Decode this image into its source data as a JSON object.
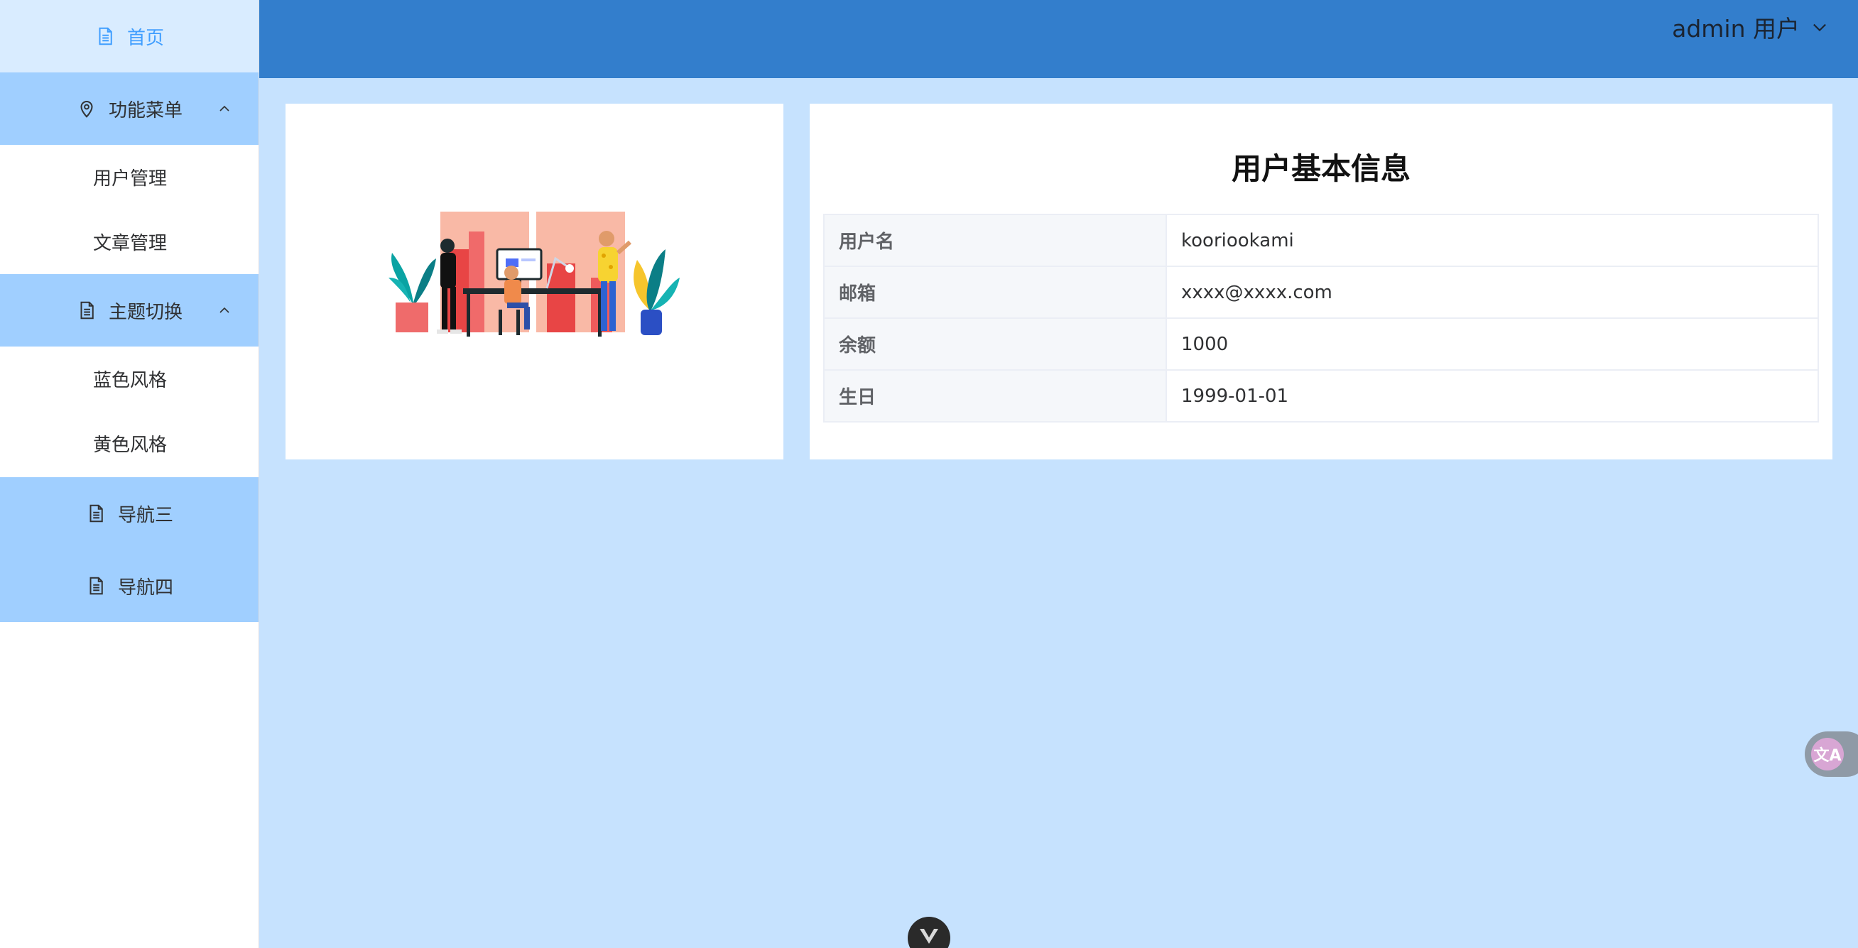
{
  "sidebar": {
    "home": {
      "label": "首页",
      "icon": "document-icon"
    },
    "function_menu": {
      "label": "功能菜单",
      "icon": "location-icon",
      "expanded": true,
      "children": [
        {
          "label": "用户管理"
        },
        {
          "label": "文章管理"
        }
      ]
    },
    "theme_switch": {
      "label": "主题切换",
      "icon": "document-icon",
      "expanded": true,
      "children": [
        {
          "label": "蓝色风格"
        },
        {
          "label": "黄色风格"
        }
      ]
    },
    "nav3": {
      "label": "导航三",
      "icon": "document-icon"
    },
    "nav4": {
      "label": "导航四",
      "icon": "document-icon"
    }
  },
  "header": {
    "user_label": "admin 用户",
    "dropdown_icon": "chevron-down-icon"
  },
  "info": {
    "title": "用户基本信息",
    "rows": [
      {
        "key": "用户名",
        "value": "kooriookami"
      },
      {
        "key": "邮箱",
        "value": "xxxx@xxxx.com"
      },
      {
        "key": "余额",
        "value": "1000"
      },
      {
        "key": "生日",
        "value": "1999-01-01"
      }
    ]
  },
  "widgets": {
    "translate_glyph": "文A",
    "translate_icon": "translate-icon",
    "devtools_icon": "vue-devtools-icon"
  },
  "colors": {
    "header": "#337ecc",
    "content_bg": "#c6e2fe",
    "menu_active_bg": "#d9ecff",
    "menu_active_text": "#409eff",
    "menu_group_bg": "#a0cfff"
  }
}
